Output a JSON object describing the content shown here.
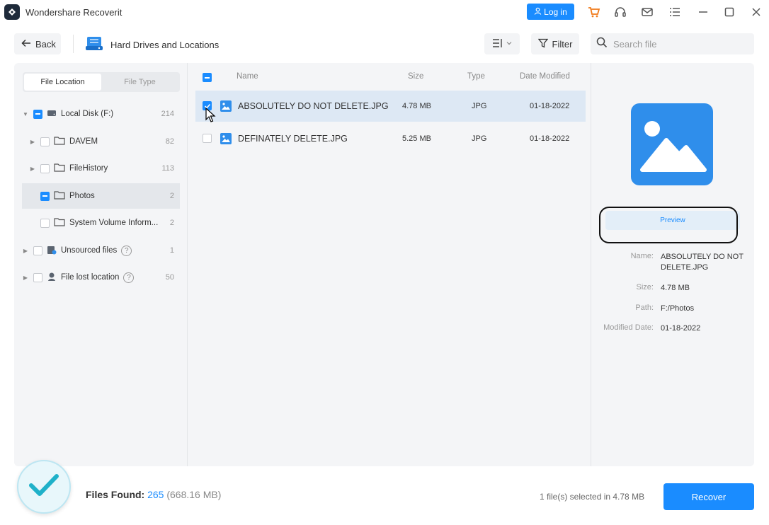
{
  "app": {
    "title": "Wondershare Recoverit"
  },
  "titlebar": {
    "login_label": "Log in"
  },
  "toolbar": {
    "back_label": "Back",
    "breadcrumb": "Hard Drives and Locations",
    "filter_label": "Filter",
    "search_placeholder": "Search file"
  },
  "sidebar": {
    "tabs": [
      {
        "label": "File Location",
        "active": true
      },
      {
        "label": "File Type",
        "active": false
      }
    ],
    "tree": [
      {
        "label": "Local Disk (F:)",
        "count": "214"
      },
      {
        "label": "DAVEM",
        "count": "82"
      },
      {
        "label": "FileHistory",
        "count": "113"
      },
      {
        "label": "Photos",
        "count": "2"
      },
      {
        "label": "System Volume Inform...",
        "count": "2"
      },
      {
        "label": "Unsourced files",
        "count": "1"
      },
      {
        "label": "File lost location",
        "count": "50"
      }
    ]
  },
  "file_list": {
    "columns": {
      "name": "Name",
      "size": "Size",
      "type": "Type",
      "date": "Date Modified"
    },
    "rows": [
      {
        "name": "ABSOLUTELY DO NOT DELETE.JPG",
        "size": "4.78 MB",
        "type": "JPG",
        "date": "01-18-2022",
        "checked": true
      },
      {
        "name": "DEFINATELY DELETE.JPG",
        "size": "5.25 MB",
        "type": "JPG",
        "date": "01-18-2022",
        "checked": false
      }
    ]
  },
  "details": {
    "preview_label": "Preview",
    "name_label": "Name:",
    "name_value": "ABSOLUTELY DO NOT DELETE.JPG",
    "size_label": "Size:",
    "size_value": "4.78 MB",
    "path_label": "Path:",
    "path_value": "F:/Photos",
    "modified_label": "Modified Date:",
    "modified_value": "01-18-2022"
  },
  "footer": {
    "files_found_label": "Files Found:",
    "files_found_count": "265",
    "files_found_size": "(668.16 MB)",
    "selected_info": "1 file(s) selected in 4.78 MB",
    "recover_label": "Recover"
  },
  "colors": {
    "accent": "#1a8cff",
    "image_icon": "#2f8eeb",
    "panel_bg": "#f4f5f7",
    "selected_row": "#dde8f4"
  },
  "icons": [
    "app-logo-icon",
    "user-icon",
    "cart-icon",
    "headset-icon",
    "mail-icon",
    "list-icon",
    "minimize-icon",
    "maximize-icon",
    "close-icon",
    "back-arrow-icon",
    "hard-drive-icon",
    "view-toggle-icon",
    "filter-icon",
    "search-icon",
    "folder-icon",
    "image-file-icon",
    "help-icon",
    "checkmark-icon"
  ]
}
